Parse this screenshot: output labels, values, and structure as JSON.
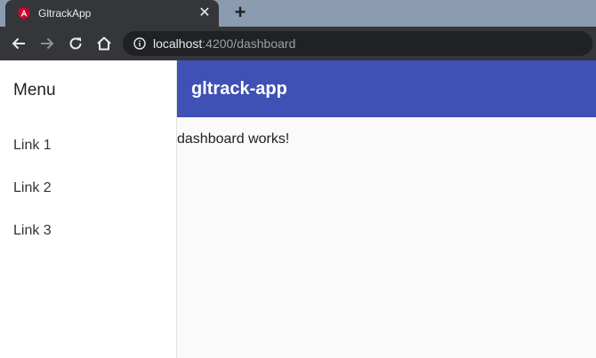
{
  "browser": {
    "tab_title": "GltrackApp",
    "tab_close": "✕",
    "new_tab": "+",
    "url_host": "localhost",
    "url_rest": ":4200/dashboard"
  },
  "sidenav": {
    "title": "Menu",
    "links": [
      {
        "label": "Link 1"
      },
      {
        "label": "Link 2"
      },
      {
        "label": "Link 3"
      }
    ]
  },
  "toolbar": {
    "title": "gltrack-app"
  },
  "content": {
    "text": "dashboard works!"
  },
  "colors": {
    "appbar": "#3f51b5",
    "favicon": "#dd0031"
  }
}
